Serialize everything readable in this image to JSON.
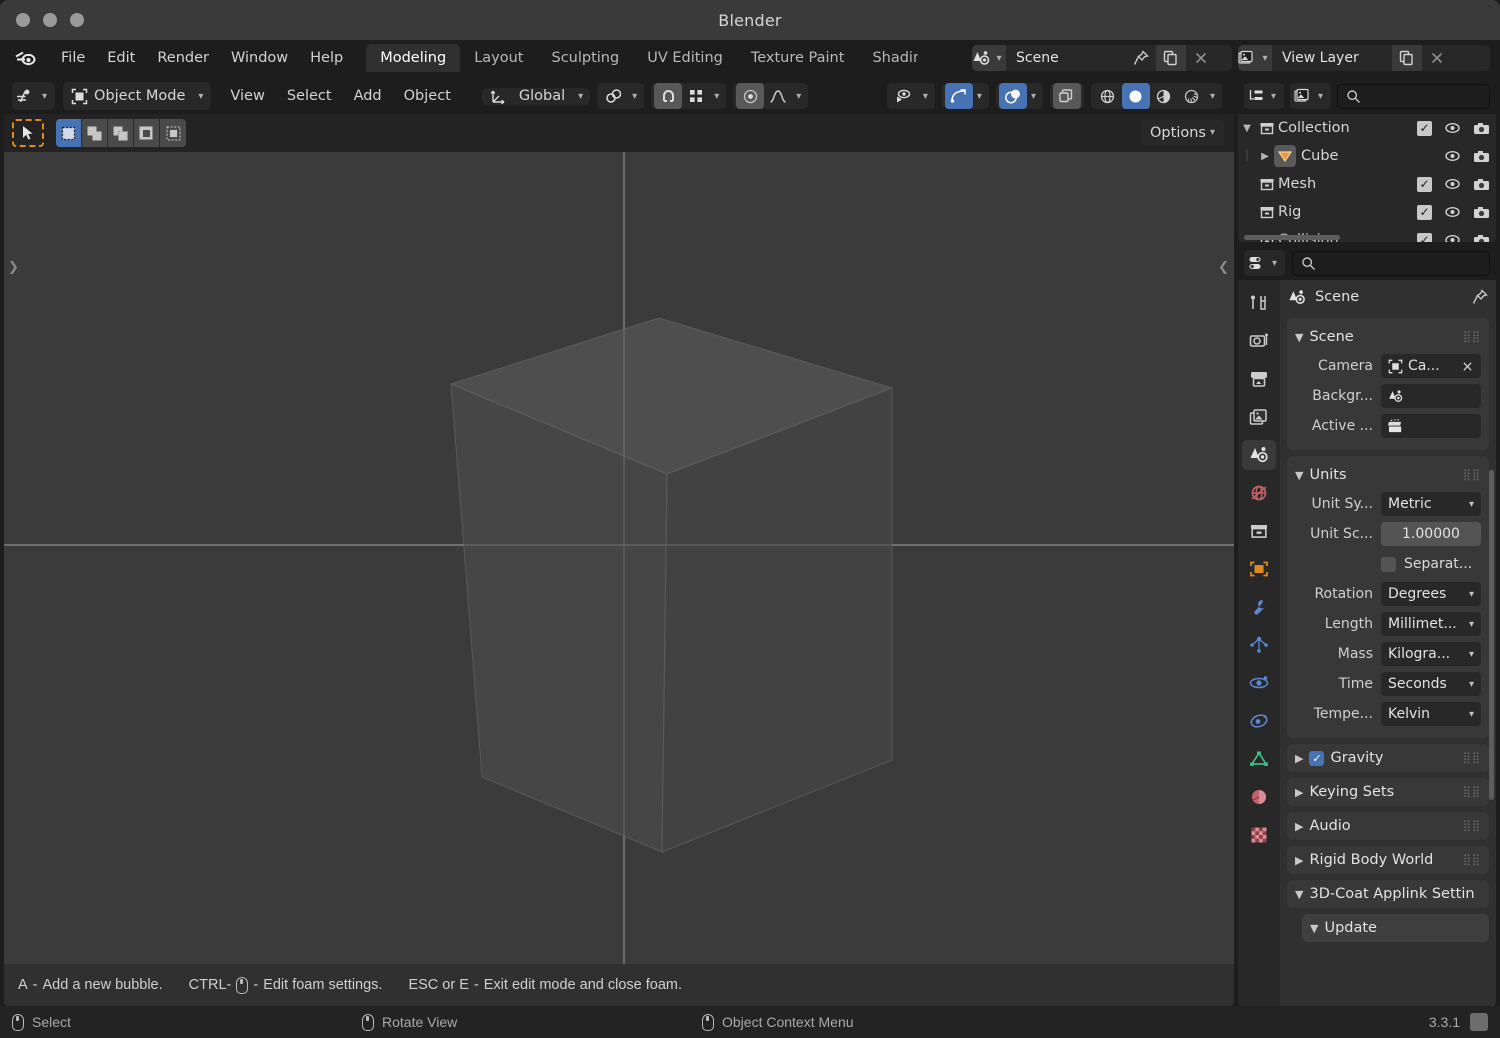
{
  "window": {
    "title": "Blender",
    "controls": [
      "close",
      "minimize",
      "maximize"
    ]
  },
  "topbar": {
    "menus": [
      "File",
      "Edit",
      "Render",
      "Window",
      "Help"
    ],
    "workspace_tabs": [
      {
        "label": "Modeling",
        "active": true
      },
      {
        "label": "Layout",
        "active": false
      },
      {
        "label": "Sculpting",
        "active": false
      },
      {
        "label": "UV Editing",
        "active": false
      },
      {
        "label": "Texture Paint",
        "active": false
      },
      {
        "label": "Shading",
        "active": false
      }
    ],
    "scene_datablock": {
      "name": "Scene",
      "icon": "scene-icon",
      "pin": "pin-icon",
      "copy": "new-scene-icon",
      "close": "x-icon"
    },
    "viewlayer_datablock": {
      "name": "View Layer",
      "icon": "view-layer-icon",
      "copy": "new-layer-icon",
      "close": "x-icon"
    }
  },
  "viewport": {
    "header": {
      "editor_type_icon": "editor-type-3dview-icon",
      "mode": "Object Mode",
      "mode_icon": "object-mode-icon",
      "menus": [
        "View",
        "Select",
        "Add",
        "Object"
      ],
      "transform_orientation": "Global",
      "transform_orientation_icon": "orientation-icon",
      "pivot_icon": "pivot-point-icon",
      "snap_icon": "magnet-icon",
      "snap_target_icon": "snap-grid-icon",
      "proportional_icon": "proportional-edit-icon",
      "falloff_icon": "falloff-curve-icon",
      "visibility_icon": "visibility-eye-icon",
      "gizmo_icon": "gizmo-icon",
      "overlays_icon": "overlays-icon",
      "xray_icon": "xray-toggle-icon",
      "shading_modes": [
        {
          "name": "wireframe-shading-icon",
          "active": false
        },
        {
          "name": "solid-shading-icon",
          "active": true
        },
        {
          "name": "material-preview-shading-icon",
          "active": false
        },
        {
          "name": "rendered-shading-icon",
          "active": false
        }
      ]
    },
    "toolsettings": {
      "active_tool_icon": "tweak-select-tool-icon",
      "select_modes": [
        {
          "name": "select-new-icon",
          "active": true
        },
        {
          "name": "select-extend-icon",
          "active": false
        },
        {
          "name": "select-subtract-icon",
          "active": false
        },
        {
          "name": "select-difference-icon",
          "active": false
        },
        {
          "name": "select-intersect-icon",
          "active": false
        }
      ],
      "options_label": "Options"
    },
    "footer_hints": [
      {
        "prefix": "A",
        "sep": " - ",
        "text": "Add a new bubble.",
        "mouse": false
      },
      {
        "prefix": "CTRL-",
        "sep": " - ",
        "text": "Edit foam settings.",
        "mouse": true
      },
      {
        "prefix": "ESC or E",
        "sep": " - ",
        "text": "Exit edit mode and close foam.",
        "mouse": false
      }
    ],
    "scene_object": "Cube"
  },
  "outliner": {
    "display_mode_icon": "outliner-display-mode-icon",
    "filter_icon": "outliner-filter-icon",
    "search_placeholder": "",
    "search_icon": "search-icon",
    "rows": [
      {
        "name": "Collection",
        "icon": "collection-icon",
        "indent": 0,
        "disclosure": "open",
        "checkbox": true,
        "eye": true,
        "camera": true,
        "selected": false
      },
      {
        "name": "Cube",
        "icon": "mesh-data-icon",
        "indent": 1,
        "disclosure": "closed",
        "checkbox": false,
        "eye": true,
        "camera": true,
        "selected": true
      },
      {
        "name": "Mesh",
        "icon": "collection-icon",
        "indent": 0,
        "disclosure": "none",
        "checkbox": true,
        "eye": true,
        "camera": true,
        "selected": false
      },
      {
        "name": "Rig",
        "icon": "collection-icon",
        "indent": 0,
        "disclosure": "none",
        "checkbox": true,
        "eye": true,
        "camera": true,
        "selected": false
      },
      {
        "name": "Collision",
        "icon": "collection-icon",
        "indent": 0,
        "disclosure": "none",
        "checkbox": true,
        "eye": true,
        "camera": true,
        "selected": false
      }
    ]
  },
  "properties": {
    "header": {
      "editor_type_icon": "editor-type-properties-icon",
      "search_icon": "search-icon",
      "search_placeholder": ""
    },
    "tabs": [
      {
        "name": "tool-tab",
        "icon": "tool-icon",
        "active": false
      },
      {
        "name": "render-tab",
        "icon": "render-camera-icon",
        "active": false
      },
      {
        "name": "output-tab",
        "icon": "printer-output-icon",
        "active": false
      },
      {
        "name": "viewlayer-tab",
        "icon": "view-layer-images-icon",
        "active": false
      },
      {
        "name": "scene-tab",
        "icon": "scene-cone-icon",
        "active": true
      },
      {
        "name": "world-tab",
        "icon": "world-globe-icon",
        "active": false
      },
      {
        "name": "collection-tab",
        "icon": "collection-box-icon",
        "active": false
      },
      {
        "name": "object-tab",
        "icon": "object-square-icon",
        "active": false
      },
      {
        "name": "modifiers-tab",
        "icon": "wrench-icon",
        "active": false
      },
      {
        "name": "particles-tab",
        "icon": "particles-icon",
        "active": false
      },
      {
        "name": "physics-tab",
        "icon": "physics-orbit-icon",
        "active": false
      },
      {
        "name": "constraints-tab",
        "icon": "object-constraints-icon",
        "active": false
      },
      {
        "name": "data-tab",
        "icon": "mesh-data-triangle-icon",
        "active": false
      },
      {
        "name": "material-tab",
        "icon": "material-sphere-icon",
        "active": false
      },
      {
        "name": "texture-tab",
        "icon": "texture-checker-icon",
        "active": false
      }
    ],
    "breadcrumb": {
      "icon": "scene-cone-icon",
      "label": "Scene",
      "pin_icon": "pin-icon"
    },
    "scene_panel": {
      "title": "Scene",
      "expanded": true,
      "rows": [
        {
          "label": "Camera",
          "value": "Ca...",
          "icon": "camera-object-icon",
          "type": "datablock",
          "clear": "x-icon"
        },
        {
          "label": "Backgr...",
          "value": "",
          "icon": "scene-cone-icon",
          "type": "datablock"
        },
        {
          "label": "Active ...",
          "value": "",
          "icon": "clapperboard-icon",
          "type": "datablock"
        }
      ]
    },
    "units_panel": {
      "title": "Units",
      "expanded": true,
      "rows": [
        {
          "label": "Unit Sy...",
          "value": "Metric",
          "type": "dropdown"
        },
        {
          "label": "Unit Sc...",
          "value": "1.00000",
          "type": "number"
        },
        {
          "label": "",
          "value": "Separat...",
          "type": "checkbox",
          "checked": false
        },
        {
          "label": "Rotation",
          "value": "Degrees",
          "type": "dropdown"
        },
        {
          "label": "Length",
          "value": "Millimet...",
          "type": "dropdown"
        },
        {
          "label": "Mass",
          "value": "Kilogra...",
          "type": "dropdown"
        },
        {
          "label": "Time",
          "value": "Seconds",
          "type": "dropdown"
        },
        {
          "label": "Tempe...",
          "value": "Kelvin",
          "type": "dropdown"
        }
      ]
    },
    "collapsed_panels": [
      {
        "title": "Gravity",
        "checkbox": true,
        "checked": true,
        "expanded": false
      },
      {
        "title": "Keying Sets",
        "checkbox": false,
        "expanded": false
      },
      {
        "title": "Audio",
        "checkbox": false,
        "expanded": false
      },
      {
        "title": "Rigid Body World",
        "checkbox": false,
        "expanded": false
      },
      {
        "title": "3D-Coat Applink Settin",
        "checkbox": false,
        "expanded": true
      },
      {
        "title": "Update",
        "checkbox": false,
        "expanded": true,
        "sub": true
      }
    ]
  },
  "statusbar": {
    "items": [
      {
        "icon": "mouse-left-icon",
        "label": "Select"
      },
      {
        "icon": "mouse-middle-icon",
        "label": "Rotate View"
      },
      {
        "icon": "mouse-right-icon",
        "label": "Object Context Menu"
      }
    ],
    "version": "3.3.1"
  },
  "colors": {
    "accent_blue": "#4772b3",
    "accent_orange": "#e08a1e",
    "window_bg": "#1d1d1d",
    "panel_bg": "#303030",
    "viewport_bg": "#3b3b3b"
  }
}
